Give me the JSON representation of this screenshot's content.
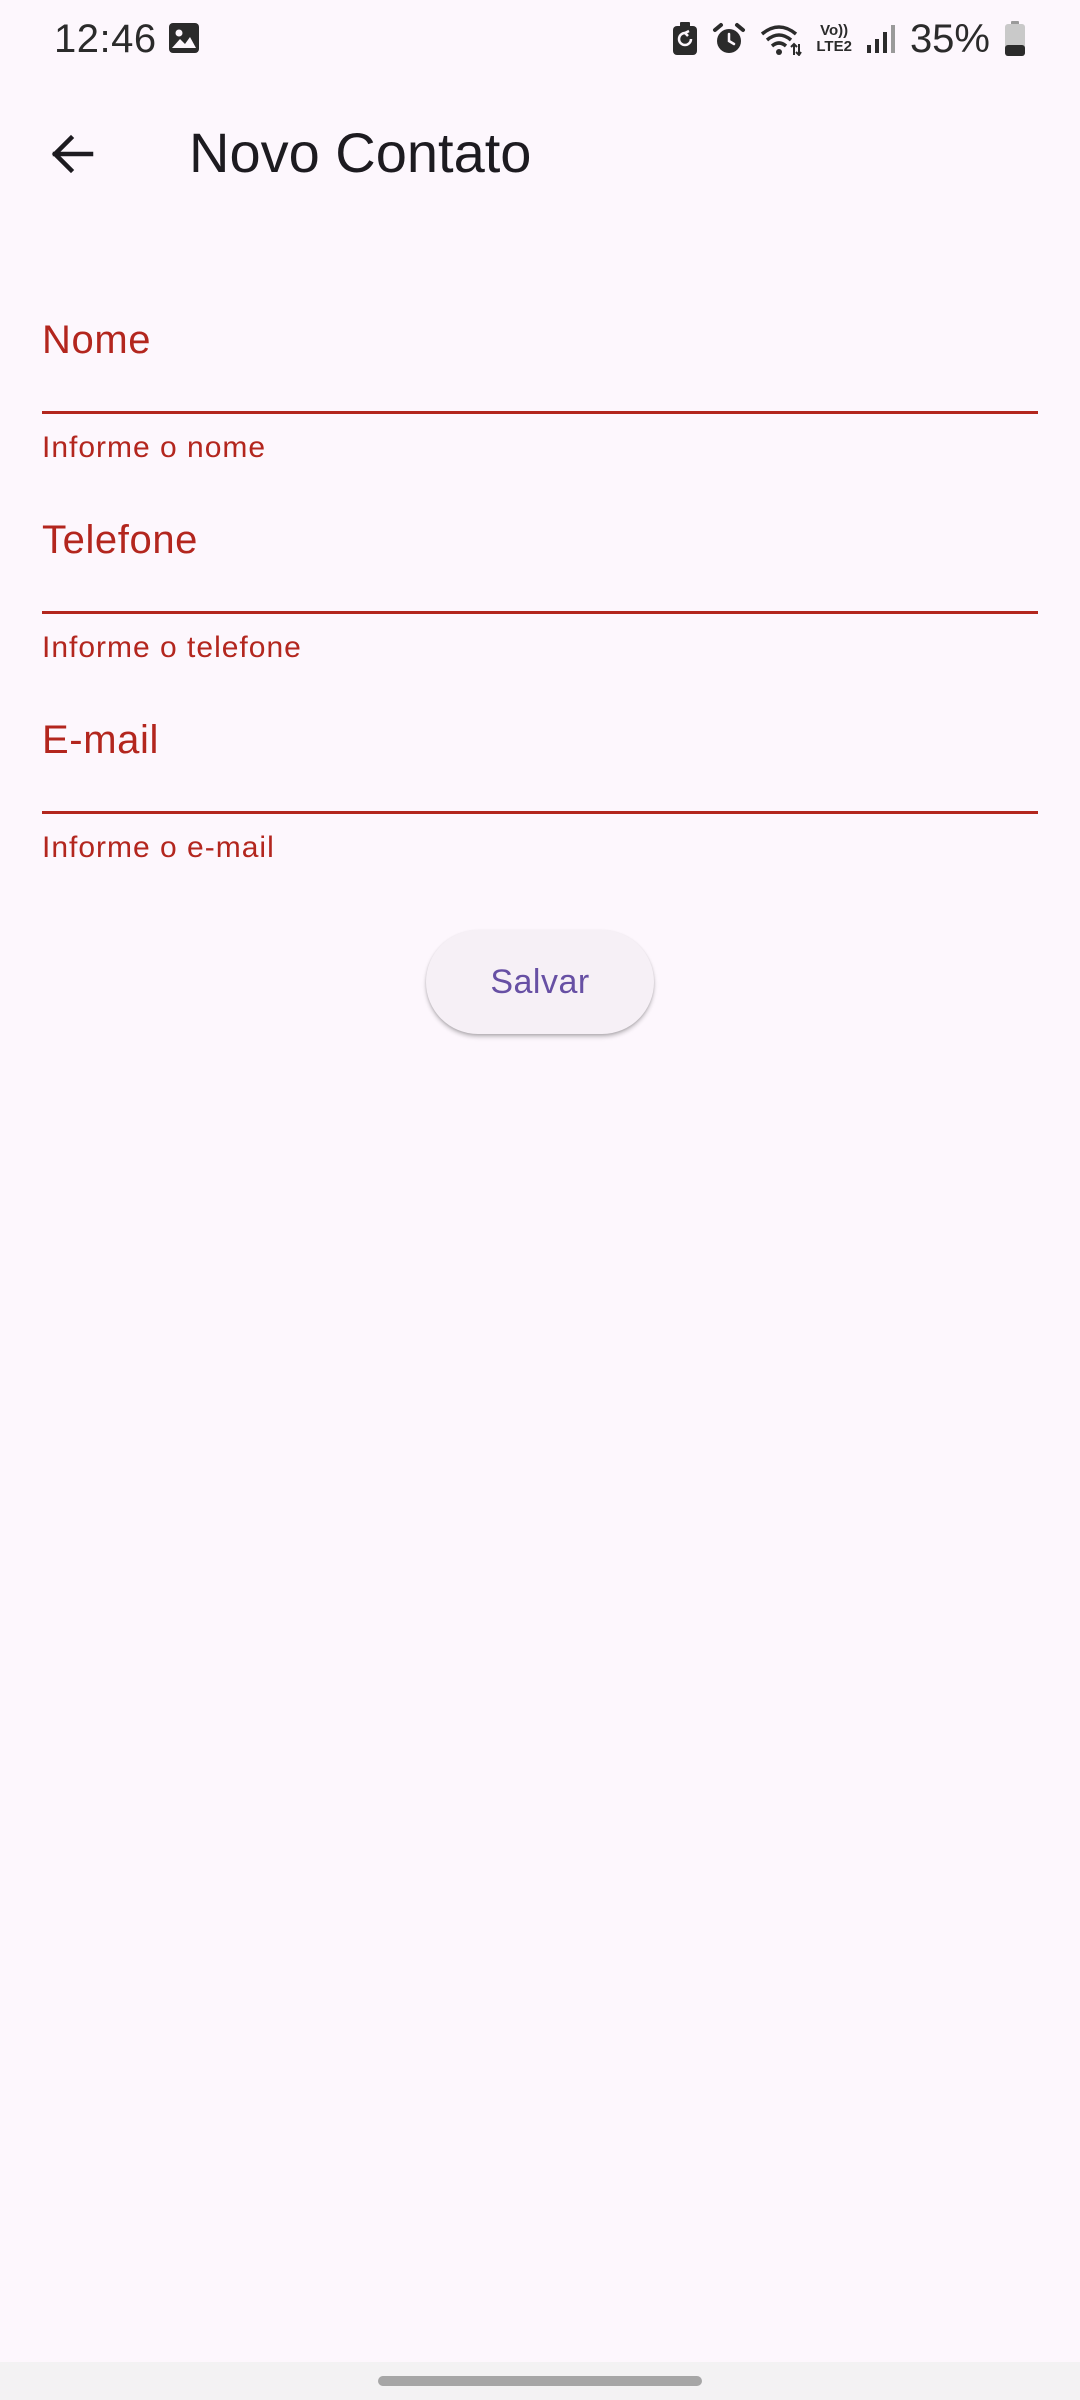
{
  "status_bar": {
    "time": "12:46",
    "volte_top": "Vo))",
    "volte_bottom": "LTE2",
    "battery_percent": "35%",
    "battery_level": 0.35,
    "icons": [
      "gallery-icon",
      "sync-icon",
      "alarm-icon",
      "wifi-icon",
      "volte-icon",
      "signal-icon",
      "battery-icon"
    ]
  },
  "app_bar": {
    "back_icon": "arrow-back-icon",
    "title": "Novo Contato"
  },
  "form": {
    "fields": [
      {
        "label": "Nome",
        "error": "Informe o nome",
        "value": ""
      },
      {
        "label": "Telefone",
        "error": "Informe o telefone",
        "value": ""
      },
      {
        "label": "E-mail",
        "error": "Informe o e-mail",
        "value": ""
      }
    ],
    "save_label": "Salvar"
  },
  "colors": {
    "background": "#fdf7fd",
    "error": "#b3261e",
    "primary": "#6750a4",
    "button_bg": "#f6f0f6",
    "on_surface": "#1d1b20"
  }
}
